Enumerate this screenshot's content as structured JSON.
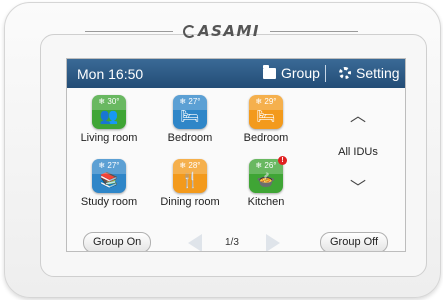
{
  "brand": {
    "name": "ASAMI"
  },
  "topbar": {
    "time": "Mon  16:50",
    "group_label": "Group",
    "setting_label": "Setting"
  },
  "rooms": [
    {
      "label": "Living room",
      "temp": "❄ 30°",
      "color": "#3fa535",
      "icon": "people-icon",
      "glyph": "👥",
      "badge": ""
    },
    {
      "label": "Bedroom",
      "temp": "❄ 27°",
      "color": "#2f86c8",
      "icon": "bed-icon",
      "glyph": "🛏",
      "badge": ""
    },
    {
      "label": "Bedroom",
      "temp": "❄ 29°",
      "color": "#f39a1c",
      "icon": "bed-icon",
      "glyph": "🛏",
      "badge": ""
    },
    {
      "label": "Study room",
      "temp": "❄ 27°",
      "color": "#2f86c8",
      "icon": "books-icon",
      "glyph": "📚",
      "badge": ""
    },
    {
      "label": "Dining room",
      "temp": "❄ 28°",
      "color": "#f39a1c",
      "icon": "fork-knife-icon",
      "glyph": "🍴",
      "badge": ""
    },
    {
      "label": "Kitchen",
      "temp": "❄ 26°",
      "color": "#3fa535",
      "icon": "pot-icon",
      "glyph": "🍲",
      "badge": "!"
    }
  ],
  "side": {
    "up_icon": "chevron-up-icon",
    "all_idus_label": "All IDUs",
    "down_icon": "chevron-down-icon"
  },
  "footer": {
    "group_on_label": "Group On",
    "page_indicator": "1/3",
    "group_off_label": "Group Off"
  },
  "colors": {
    "topbar": "#2c5984",
    "green": "#3fa535",
    "blue": "#2f86c8",
    "orange": "#f39a1c",
    "alert": "#e02020"
  }
}
